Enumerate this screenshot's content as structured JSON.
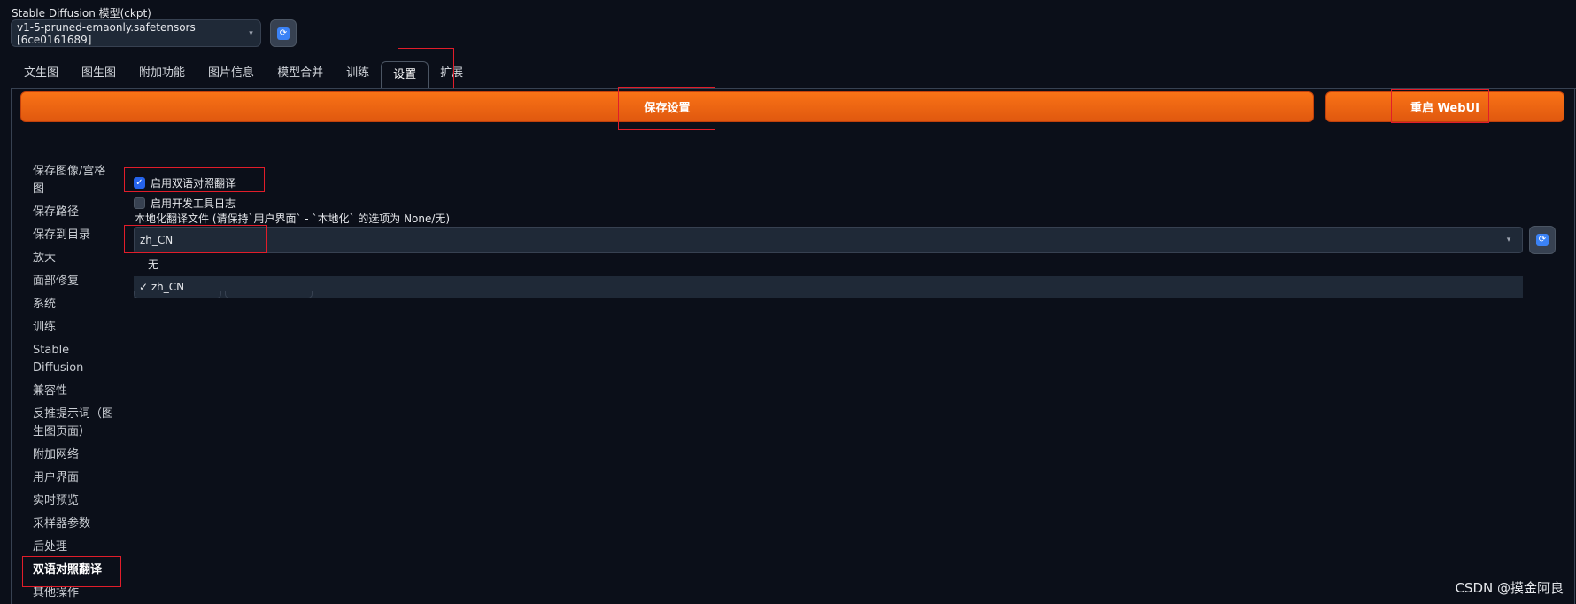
{
  "model": {
    "label": "Stable Diffusion 模型(ckpt)",
    "value": "v1-5-pruned-emaonly.safetensors [6ce0161689]"
  },
  "icons": {
    "refresh": "refresh-icon",
    "caret": "chevron-down-icon"
  },
  "tabs": [
    "文生图",
    "图生图",
    "附加功能",
    "图片信息",
    "模型合并",
    "训练",
    "设置",
    "扩展"
  ],
  "active_tab": "设置",
  "actions": {
    "save": "保存设置",
    "restart": "重启 WebUI"
  },
  "sidebar": {
    "items": [
      "保存图像/宫格图",
      "保存路径",
      "保存到目录",
      "放大",
      "面部修复",
      "系统",
      "训练",
      "Stable Diffusion",
      "兼容性",
      "反推提示词（图生图页面）",
      "附加网络",
      "用户界面",
      "实时预览",
      "采样器参数",
      "后处理",
      "双语对照翻译",
      "其他操作"
    ],
    "active": "双语对照翻译"
  },
  "settings": {
    "enable_bilingual": {
      "label": "启用双语对照翻译",
      "checked": true
    },
    "enable_devtools_log": {
      "label": "启用开发工具日志",
      "checked": false
    },
    "localization": {
      "label": "本地化翻译文件 (请保持`用户界面` - `本地化` 的选项为 None/无)",
      "value": "zh_CN",
      "options": [
        "无",
        "✓ zh_CN"
      ]
    }
  },
  "watermark": "CSDN @摸金阿良",
  "colors": {
    "accent": "#f97316",
    "highlight": "#e11d2a",
    "background": "#0b0f19"
  }
}
